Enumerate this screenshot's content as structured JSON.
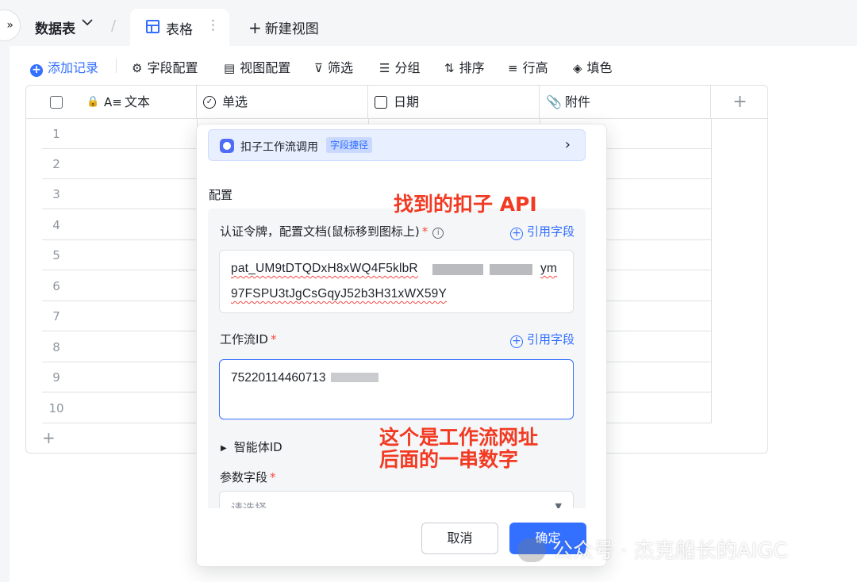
{
  "topbar": {
    "collapse_icon": "»",
    "table_name": "数据表",
    "table_name_icon": "chevron-down-icon",
    "active_tab": "表格",
    "tab_more_icon": "⋮",
    "new_view": "新建视图"
  },
  "toolbar": {
    "add_record": "添加记录",
    "field_config": "字段配置",
    "view_config": "视图配置",
    "filter": "筛选",
    "group": "分组",
    "sort": "排序",
    "row_height": "行高",
    "fill_color": "填色"
  },
  "grid": {
    "columns": [
      {
        "label": "文本",
        "icon": "text-field-icon"
      },
      {
        "label": "单选",
        "icon": "single-select-icon"
      },
      {
        "label": "日期",
        "icon": "calendar-icon"
      },
      {
        "label": "附件",
        "icon": "attachment-icon"
      }
    ],
    "add_column": "+",
    "rows": [
      "1",
      "2",
      "3",
      "4",
      "5",
      "6",
      "7",
      "8",
      "9",
      "10"
    ],
    "add_row": "+"
  },
  "panel": {
    "banner_title": "扣子工作流调用",
    "banner_tag": "字段捷径",
    "section_label": "配置",
    "token_label": "认证令牌，配置文档(鼠标移到图标上)",
    "required_mark": "*",
    "ref_field": "引用字段",
    "token_value_line1": "pat_UM9tDTQDxH8xWQ4F5klbR",
    "token_value_line1_end": "ym",
    "token_value_line2": "97FSPU3tJgCsGqyJ52b3H31xWX59Y",
    "workflow_label": "工作流ID",
    "workflow_value": "75220114460713",
    "agent_label": "智能体ID",
    "params_label": "参数字段",
    "params_placeholder": "请选择",
    "cancel": "取消",
    "confirm": "确定"
  },
  "annotations": {
    "api_note": "找到的扣子 API",
    "workflow_note_line1": "这个是工作流网址",
    "workflow_note_line2": "后面的一串数字"
  },
  "watermark": "公众号 · 杰克船长的AIGC",
  "colors": {
    "accent": "#3370ff",
    "annotation_red": "#f23a23",
    "required_red": "#f54a45",
    "banner_bg": "#e8efff"
  }
}
